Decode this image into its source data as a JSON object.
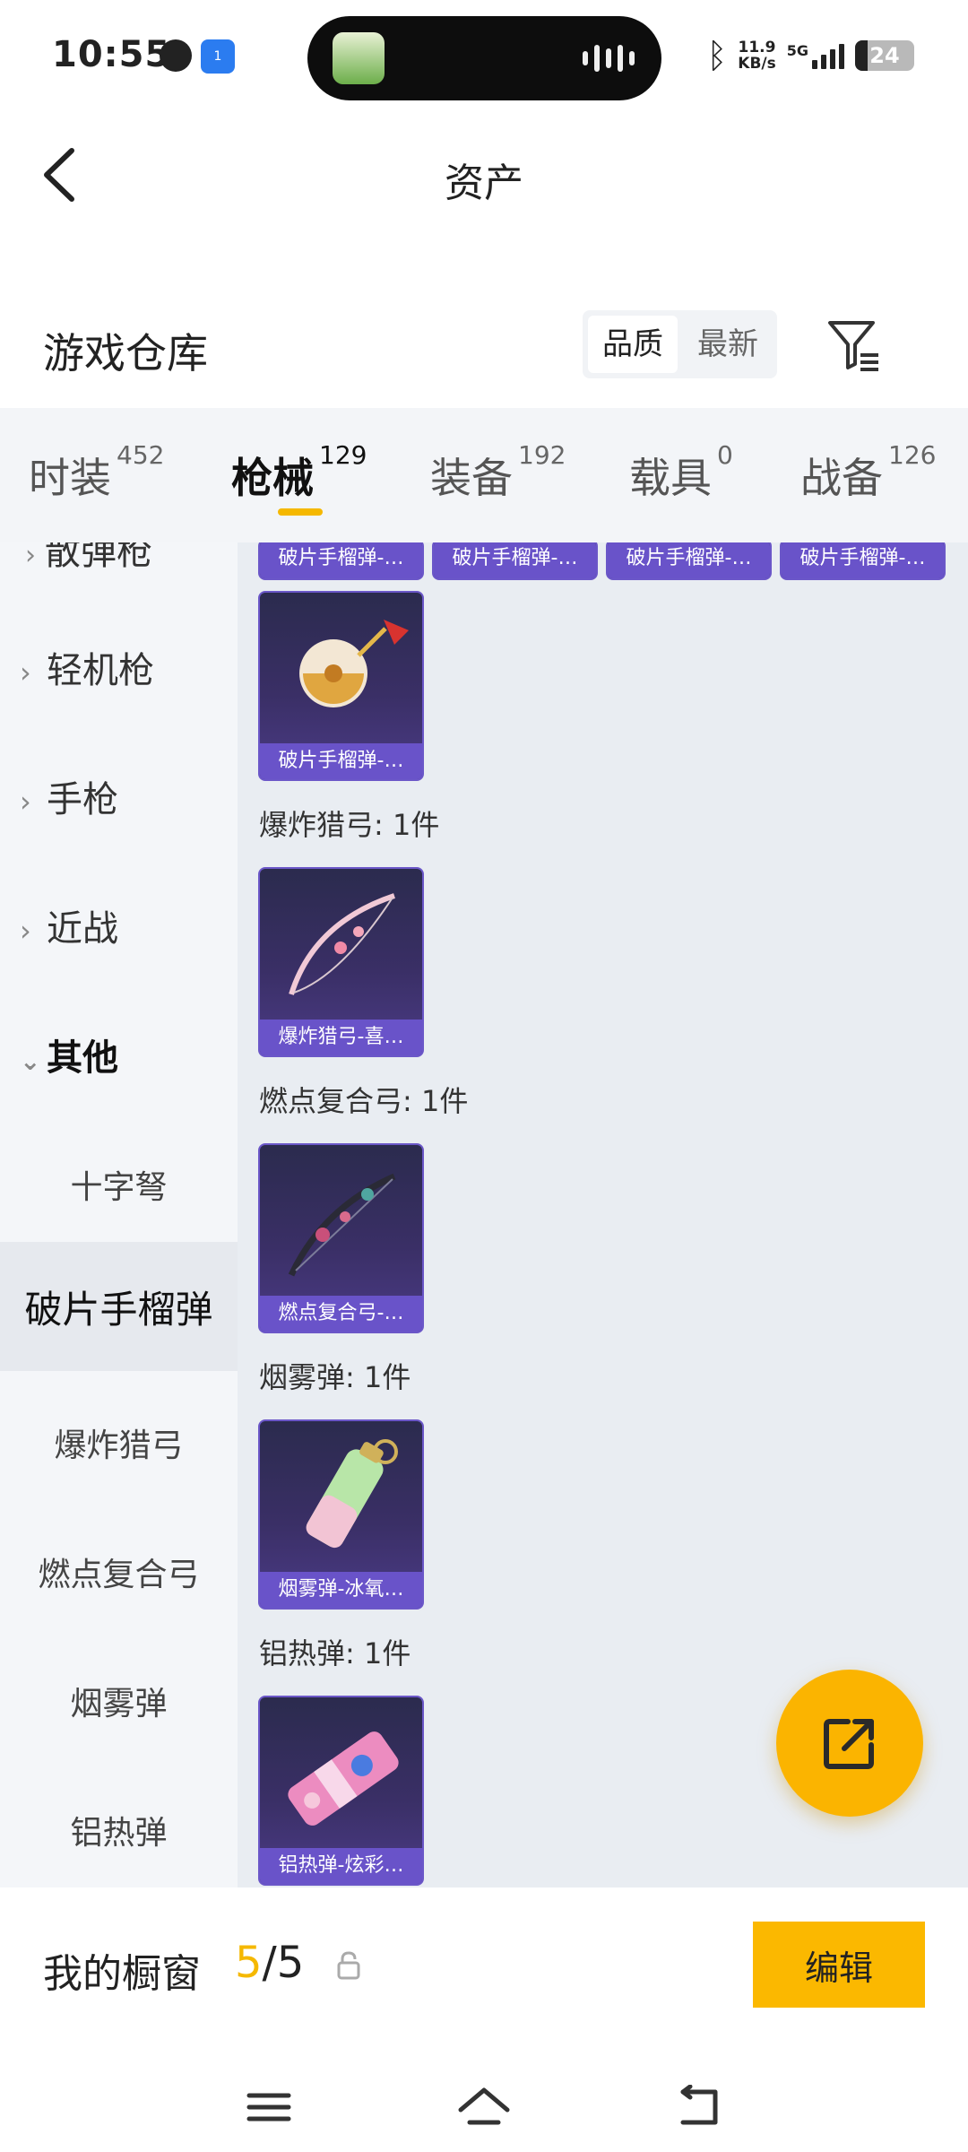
{
  "status_bar": {
    "time": "10:55",
    "speed_top": "11.9",
    "speed_unit": "KB/s",
    "network": "5G",
    "battery": "24",
    "notif_badge": "1"
  },
  "header": {
    "title": "资产",
    "back_icon": "back-arrow-icon"
  },
  "warehouse": {
    "title": "游戏仓库",
    "sort_options": [
      "品质",
      "最新"
    ],
    "sort_selected": "品质",
    "filter_icon": "filter-icon"
  },
  "tabs": [
    {
      "label": "时装",
      "count": "452"
    },
    {
      "label": "枪械",
      "count": "129"
    },
    {
      "label": "装备",
      "count": "192"
    },
    {
      "label": "载具",
      "count": "0"
    },
    {
      "label": "战备",
      "count": "126"
    }
  ],
  "active_tab": "枪械",
  "sidebar": {
    "partial_top": "散弹枪",
    "groups": [
      {
        "label": "轻机枪",
        "expanded": false
      },
      {
        "label": "手枪",
        "expanded": false
      },
      {
        "label": "近战",
        "expanded": false
      },
      {
        "label": "其他",
        "expanded": true
      }
    ],
    "sub_items": [
      "十字弩",
      "破片手榴弹",
      "爆炸猎弓",
      "燃点复合弓",
      "烟雾弹",
      "铝热弹"
    ],
    "active": "破片手榴弹"
  },
  "content": {
    "top_row_label": "破片手榴弹-…",
    "grenade_card": "破片手榴弹-…",
    "sections": [
      {
        "header": "爆炸猎弓: 1件",
        "card": "爆炸猎弓-喜…"
      },
      {
        "header": "燃点复合弓: 1件",
        "card": "燃点复合弓-…"
      },
      {
        "header": "烟雾弹: 1件",
        "card": "烟雾弹-冰氧…"
      },
      {
        "header": "铝热弹: 1件",
        "card": "铝热弹-炫彩…"
      }
    ]
  },
  "fab_icon": "share-export-icon",
  "bottom": {
    "title": "我的橱窗",
    "count_current": "5",
    "count_sep": "/",
    "count_total": "5",
    "edit_label": "编辑"
  },
  "colors": {
    "accent": "#fbb800",
    "card_label": "#6953c9",
    "card_bg": "#3a2f66"
  }
}
